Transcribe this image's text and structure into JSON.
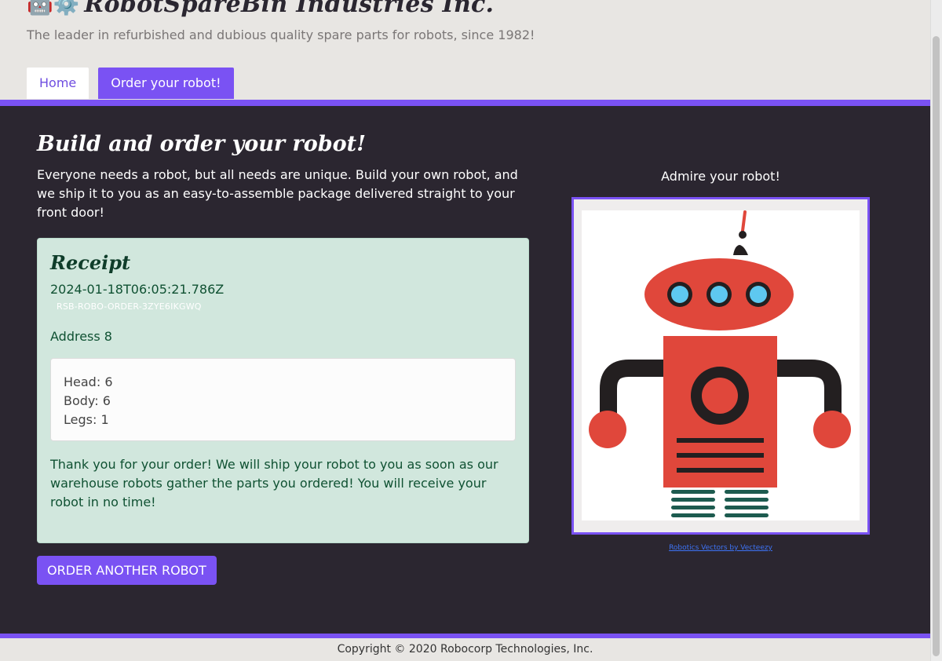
{
  "header": {
    "logo_emoji": "🤖⚙️",
    "title": "RobotSpareBin Industries Inc.",
    "tagline": "The leader in refurbished and dubious quality spare parts for robots, since 1982!"
  },
  "nav": {
    "tabs": [
      {
        "label": "Home"
      },
      {
        "label": "Order your robot!"
      }
    ]
  },
  "main": {
    "heading": "Build and order your robot!",
    "intro": "Everyone needs a robot, but all needs are unique. Build your own robot, and we ship it to you as an easy-to-assemble package delivered straight to your front door!",
    "receipt": {
      "title": "Receipt",
      "timestamp": "2024-01-18T06:05:21.786Z",
      "order_id": "RSB-ROBO-ORDER-3ZYE6IKGWQ",
      "address": "Address 8",
      "parts": {
        "head": "Head: 6",
        "body": "Body: 6",
        "legs": "Legs: 1"
      },
      "thanks": "Thank you for your order! We will ship your robot to you as soon as our warehouse robots gather the parts you ordered! You will receive your robot in no time!"
    },
    "order_another_label": "ORDER ANOTHER ROBOT",
    "preview": {
      "title": "Admire your robot!",
      "credit": "Robotics Vectors by Vecteezy"
    }
  },
  "footer": {
    "copyright": "Copyright © 2020 Robocorp Technologies, Inc."
  },
  "colors": {
    "accent": "#7a52f3",
    "dark_bg": "#2b2630",
    "receipt_bg": "#d1e7dd",
    "robot_red": "#e0473b",
    "robot_dark": "#231f20",
    "robot_eye": "#5ec8f0",
    "robot_leg": "#1d5b4f"
  }
}
